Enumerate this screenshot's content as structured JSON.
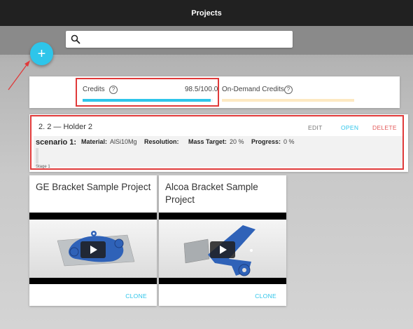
{
  "header": {
    "title": "Projects"
  },
  "search": {
    "value": "",
    "placeholder": ""
  },
  "fab": {
    "icon": "plus-icon",
    "label": "+"
  },
  "credits": {
    "credits_label": "Credits",
    "credits_value": "98.5/100.0",
    "credits_fraction": 0.985,
    "ondemand_label": "On-Demand Credits",
    "help_symbol": "?",
    "credits_color": "#2ec5ea",
    "ondemand_color": "#fde9c2"
  },
  "project": {
    "title": "2. 2 — Holder 2",
    "actions": {
      "edit": "EDIT",
      "open": "OPEN",
      "delete": "DELETE"
    },
    "scenario": {
      "name": "scenario 1:",
      "material_label": "Material:",
      "material_value": "AlSi10Mg",
      "resolution_label": "Resolution:",
      "resolution_value": "",
      "mass_label": "Mass Target:",
      "mass_value": "20 %",
      "progress_label": "Progress:",
      "progress_value": "0 %",
      "stage": "Stage 1"
    }
  },
  "samples": [
    {
      "title": "GE Bracket Sample Project",
      "clone": "CLONE"
    },
    {
      "title": "Alcoa Bracket Sample Project",
      "clone": "CLONE"
    }
  ],
  "colors": {
    "accent": "#2ec5ea",
    "delete": "#e35a5a",
    "highlight": "#e03a3a",
    "topbar": "#212121"
  }
}
